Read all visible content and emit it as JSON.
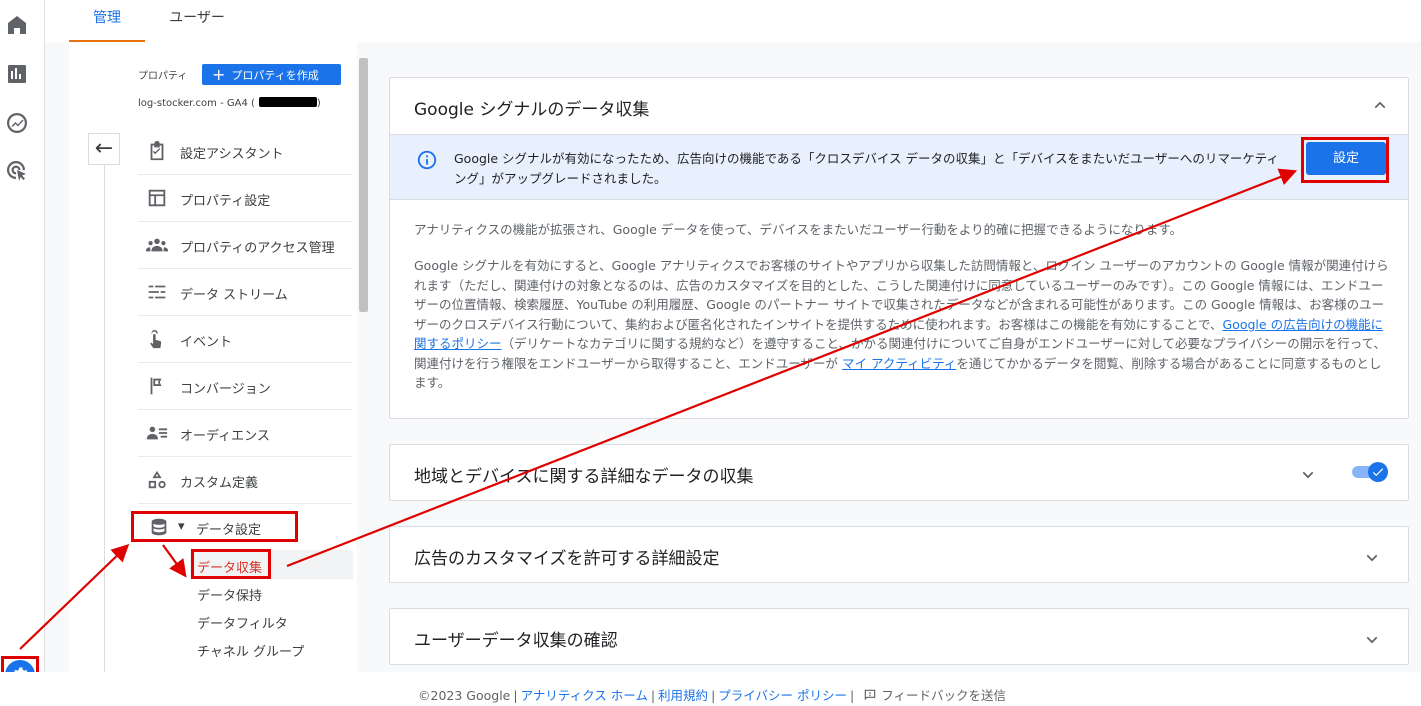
{
  "tabs": {
    "admin": "管理",
    "user": "ユーザー"
  },
  "property": {
    "label": "プロパティ",
    "create_button": "プロパティを作成",
    "name_prefix": "log-stocker.com - GA4 (",
    "name_suffix": ")"
  },
  "nav": {
    "items": [
      {
        "label": "設定アシスタント",
        "icon": "checklist-icon"
      },
      {
        "label": "プロパティ設定",
        "icon": "property-layout-icon"
      },
      {
        "label": "プロパティのアクセス管理",
        "icon": "people-icon"
      },
      {
        "label": "データ ストリーム",
        "icon": "streams-icon"
      },
      {
        "label": "イベント",
        "icon": "touch-icon"
      },
      {
        "label": "コンバージョン",
        "icon": "flag-icon"
      },
      {
        "label": "オーディエンス",
        "icon": "audience-icon"
      },
      {
        "label": "カスタム定義",
        "icon": "shapes-icon"
      }
    ],
    "data_settings": "データ設定",
    "sub_items": [
      "データ収集",
      "データ保持",
      "データフィルタ",
      "チャネル グループ"
    ]
  },
  "signals": {
    "title": "Google シグナルのデータ収集",
    "banner_text": "Google シグナルが有効になったため、広告向けの機能である「クロスデバイス データの収集」と「デバイスをまたいだユーザーへのリマーケティング」がアップグレードされました。",
    "settings_button": "設定",
    "para1": "アナリティクスの機能が拡張され、Google データを使って、デバイスをまたいだユーザー行動をより的確に把握できるようになります。",
    "para2_a": "Google シグナルを有効にすると、Google アナリティクスでお客様のサイトやアプリから収集した訪問情報と、ログイン ユーザーのアカウントの Google 情報が関連付けられます（ただし、関連付けの対象となるのは、広告のカスタマイズを目的とした、こうした関連付けに同意しているユーザーのみです）。この Google 情報には、エンドユーザーの位置情報、検索履歴、YouTube の利用履歴、Google のパートナー サイトで収集されたデータなどが含まれる可能性があります。この Google 情報は、お客様のユーザーのクロスデバイス行動について、集約および匿名化されたインサイトを提供するために使われます。お客様はこの機能を有効にすることで、",
    "para2_link1": "Google の広告向けの機能に関するポリシー",
    "para2_b": "（デリケートなカテゴリに関する規約など）を遵守すること、かかる関連付けについてご自身がエンドユーザーに対して必要なプライバシーの開示を行って、関連付けを行う権限をエンドユーザーから取得すること、エンドユーザーが ",
    "para2_link2": "マイ アクティビティ",
    "para2_c": "を通じてかかるデータを閲覧、削除する場合があることに同意するものとします。"
  },
  "cards": {
    "region": "地域とデバイスに関する詳細なデータの収集",
    "ads": "広告のカスタマイズを許可する詳細設定",
    "userdata": "ユーザーデータ収集の確認"
  },
  "toggle": {
    "on": true
  },
  "footer": {
    "copyright": "©2023 Google",
    "links": [
      "アナリティクス ホーム",
      "利用規約",
      "プライバシー ポリシー"
    ],
    "feedback": "フィードバックを送信"
  },
  "colors": {
    "accent": "#1a73e8",
    "annotation": "#e00000"
  }
}
